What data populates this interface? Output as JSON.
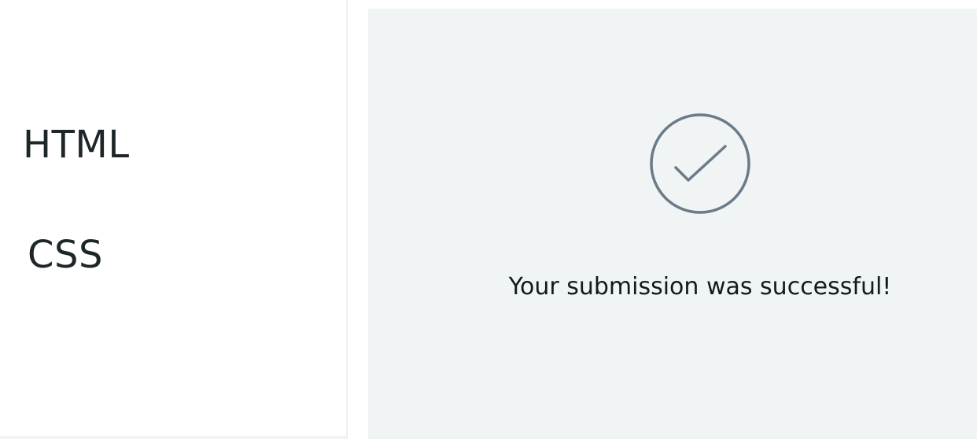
{
  "sidebar": {
    "items": [
      {
        "label": "HTML"
      },
      {
        "label": "CSS"
      }
    ]
  },
  "preview": {
    "icon": "check-circle-icon",
    "message": "Your submission was successful!"
  },
  "colors": {
    "text": "#1d2628",
    "icon_stroke": "#6b7b87",
    "preview_background": "#f0f4f4"
  }
}
